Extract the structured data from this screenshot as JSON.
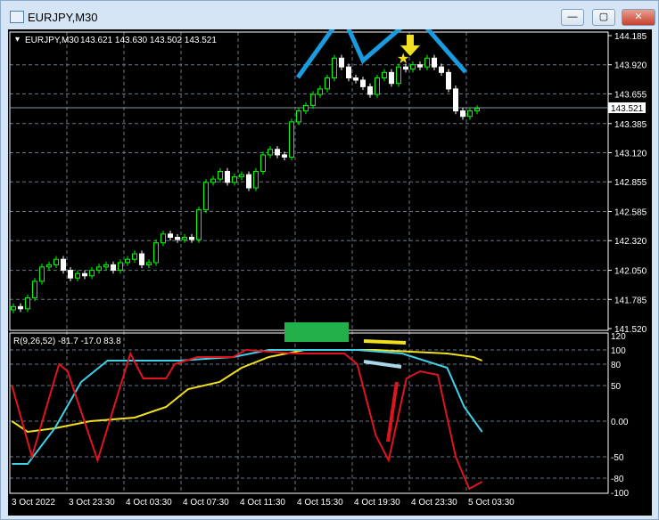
{
  "window": {
    "title": "EURJPY,M30",
    "minimize": "—",
    "maximize": "▢",
    "close": "✕"
  },
  "main_pane": {
    "label": "EURJPY,M30",
    "ohlc": "143.621 143.630 143.502 143.521",
    "current_price": "143.521",
    "price_ticks": [
      "144.185",
      "143.920",
      "143.655",
      "143.385",
      "143.120",
      "142.855",
      "142.585",
      "142.320",
      "142.050",
      "141.785",
      "141.520"
    ]
  },
  "indicator_pane": {
    "label": "R(9,26,52) -81.7 -17.0 83.8",
    "ticks": [
      "120",
      "100",
      "80",
      "50",
      "0.00",
      "-50",
      "-80",
      "-100"
    ]
  },
  "time_axis": [
    "3 Oct 2022",
    "3 Oct 23:30",
    "4 Oct 03:30",
    "4 Oct 07:30",
    "4 Oct 11:30",
    "4 Oct 15:30",
    "4 Oct 19:30",
    "4 Oct 23:30",
    "5 Oct 03:30"
  ],
  "colors": {
    "bull": "#00ff00",
    "bear": "#ffffff",
    "red": "#e0141e",
    "cyan": "#40d0e8",
    "yellow": "#f0e020",
    "annot_blue": "#1a9be0"
  },
  "chart_data": {
    "type": "candlestick",
    "closes": [
      141.72,
      141.7,
      141.8,
      141.95,
      142.08,
      142.1,
      142.15,
      142.05,
      141.98,
      142.02,
      142.0,
      142.05,
      142.08,
      142.1,
      142.05,
      142.12,
      142.15,
      142.2,
      142.1,
      142.12,
      142.3,
      142.38,
      142.35,
      142.33,
      142.35,
      142.33,
      142.6,
      142.85,
      142.88,
      142.95,
      142.85,
      142.9,
      142.92,
      142.8,
      142.95,
      143.1,
      143.15,
      143.1,
      143.08,
      143.4,
      143.5,
      143.55,
      143.65,
      143.7,
      143.8,
      143.98,
      143.9,
      143.8,
      143.78,
      143.72,
      143.65,
      143.8,
      143.85,
      143.75,
      143.9,
      143.88,
      143.92,
      143.9,
      143.98,
      143.9,
      143.85,
      143.7,
      143.5,
      143.45,
      143.5,
      143.521
    ],
    "ylim": [
      141.52,
      144.185
    ],
    "indicator_ylim": [
      -100,
      120
    ],
    "red": [
      [
        -0.2,
        50
      ],
      [
        2.6,
        -50
      ],
      [
        6.4,
        80
      ],
      [
        7.6,
        70
      ],
      [
        11.8,
        -55
      ],
      [
        16.4,
        95
      ],
      [
        18.2,
        60
      ],
      [
        21.4,
        60
      ],
      [
        22.6,
        80
      ],
      [
        25.8,
        90
      ],
      [
        30.8,
        90
      ],
      [
        32.6,
        100
      ],
      [
        39.5,
        95
      ],
      [
        42,
        95
      ],
      [
        46.4,
        95
      ],
      [
        48.2,
        80
      ],
      [
        50.8,
        -20
      ],
      [
        52.6,
        -55
      ],
      [
        55.1,
        60
      ],
      [
        57,
        70
      ],
      [
        59.5,
        65
      ],
      [
        62,
        -50
      ],
      [
        63.9,
        -95
      ],
      [
        65.7,
        -85
      ]
    ],
    "cyan": [
      [
        -0.2,
        -60
      ],
      [
        2,
        -60
      ],
      [
        5.8,
        -10
      ],
      [
        9.5,
        55
      ],
      [
        13.2,
        85
      ],
      [
        23.2,
        85
      ],
      [
        30.8,
        90
      ],
      [
        35.8,
        100
      ],
      [
        48.2,
        100
      ],
      [
        54.5,
        95
      ],
      [
        60.8,
        75
      ],
      [
        63.2,
        20
      ],
      [
        65.7,
        -15
      ]
    ],
    "yellow": [
      [
        -0.2,
        0
      ],
      [
        2,
        -15
      ],
      [
        5.8,
        -10
      ],
      [
        10.8,
        0
      ],
      [
        17,
        5
      ],
      [
        21.4,
        20
      ],
      [
        24.5,
        45
      ],
      [
        28.9,
        55
      ],
      [
        32,
        75
      ],
      [
        35.8,
        90
      ],
      [
        40.8,
        100
      ],
      [
        50.8,
        100
      ],
      [
        60.8,
        95
      ],
      [
        64.5,
        90
      ],
      [
        65.7,
        85
      ]
    ]
  }
}
